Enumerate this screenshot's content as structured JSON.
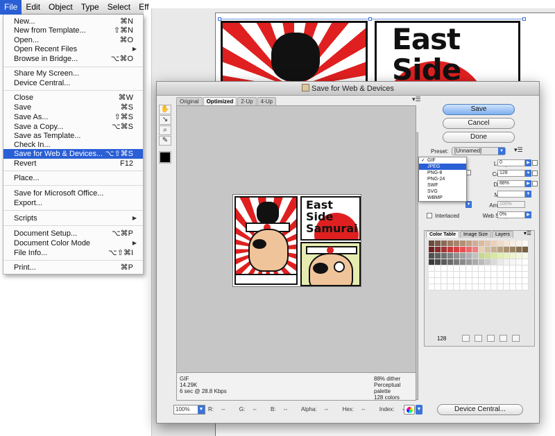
{
  "menubar": {
    "items": [
      "File",
      "Edit",
      "Object",
      "Type",
      "Select",
      "Eff"
    ]
  },
  "file_menu": {
    "items": [
      {
        "label": "New...",
        "key": "⌘N"
      },
      {
        "label": "New from Template...",
        "key": "⇧⌘N"
      },
      {
        "label": "Open...",
        "key": "⌘O"
      },
      {
        "label": "Open Recent Files",
        "key": ""
      },
      {
        "label": "Browse in Bridge...",
        "key": "⌥⌘O"
      },
      {
        "label": "Share My Screen...",
        "key": ""
      },
      {
        "label": "Device Central...",
        "key": ""
      },
      {
        "label": "Close",
        "key": "⌘W"
      },
      {
        "label": "Save",
        "key": "⌘S"
      },
      {
        "label": "Save As...",
        "key": "⇧⌘S"
      },
      {
        "label": "Save a Copy...",
        "key": "⌥⌘S"
      },
      {
        "label": "Save as Template...",
        "key": ""
      },
      {
        "label": "Check In...",
        "key": ""
      },
      {
        "label": "Save for Web & Devices...",
        "key": "⌥⇧⌘S"
      },
      {
        "label": "Revert",
        "key": "F12"
      },
      {
        "label": "Place...",
        "key": ""
      },
      {
        "label": "Save for Microsoft Office...",
        "key": ""
      },
      {
        "label": "Export...",
        "key": ""
      },
      {
        "label": "Scripts",
        "key": ""
      },
      {
        "label": "Document Setup...",
        "key": "⌥⌘P"
      },
      {
        "label": "Document Color Mode",
        "key": ""
      },
      {
        "label": "File Info...",
        "key": "⌥⇧⌘I"
      },
      {
        "label": "Print...",
        "key": "⌘P"
      }
    ],
    "highlighted": "Save for Web & Devices..."
  },
  "artwork": {
    "text_large": "East\nSide",
    "text_small": "East\nSide\nSamurai"
  },
  "dialog": {
    "title": "Save for Web & Devices",
    "tabs": [
      "Original",
      "Optimized",
      "2-Up",
      "4-Up"
    ],
    "active_tab": "Optimized",
    "buttons": {
      "save": "Save",
      "cancel": "Cancel",
      "done": "Done",
      "device_central": "Device Central..."
    },
    "preview_info": {
      "format": "GIF",
      "size": "14.29K",
      "time": "6 sec @ 28.8 Kbps",
      "dither": "88% dither",
      "palette": "Perceptual palette",
      "colors": "128 colors"
    },
    "status": {
      "zoom": "100%",
      "r": "R:",
      "r_val": "--",
      "g": "G:",
      "g_val": "--",
      "b": "B:",
      "b_val": "--",
      "alpha": "Alpha:",
      "alpha_val": "--",
      "hex": "Hex:",
      "hex_val": "--",
      "index": "Index:",
      "index_val": "--"
    },
    "settings": {
      "preset_label": "Preset:",
      "preset_value": "[Unnamed]",
      "format_options": [
        "GIF",
        "JPEG",
        "PNG-8",
        "PNG-24",
        "SWF",
        "SVG",
        "WBMP"
      ],
      "format_checked": "GIF",
      "format_highlighted": "JPEG",
      "lossy_label": "Lossy:",
      "lossy_value": "0",
      "colors_label": "Colors:",
      "colors_value": "128",
      "dither_label": "Dither:",
      "dither_value": "88%",
      "matte_label": "Matte:",
      "amount_label": "Amount:",
      "amount_value": "100%",
      "web_snap_label": "Web Snap:",
      "web_snap_value": "0%",
      "interlaced_label": "Interlaced"
    },
    "color_table": {
      "tabs": [
        "Color Table",
        "Image Size",
        "Layers"
      ],
      "active_tab": "Color Table",
      "count": "128",
      "swatches": [
        "#6b4a3a",
        "#7a5a48",
        "#8c6a55",
        "#9d7a62",
        "#a6856d",
        "#b08f77",
        "#c39e86",
        "#d1ad94",
        "#dcb9a0",
        "#e3c4ad",
        "#ebd0bb",
        "#f0dccb",
        "#f5e6d8",
        "#f8eee4",
        "#faf3ec",
        "#fcf8f3",
        "#6e2222",
        "#8a2a2a",
        "#a83232",
        "#c23a3a",
        "#d84040",
        "#e85050",
        "#e86a6a",
        "#f08080",
        "#e8d0b0",
        "#d8c0a0",
        "#c8b090",
        "#b8a080",
        "#a89070",
        "#988060",
        "#887050",
        "#786040",
        "#505050",
        "#606060",
        "#707070",
        "#808080",
        "#909090",
        "#a0a0a0",
        "#b0b0b0",
        "#c0c0c0",
        "#c8d890",
        "#d0e090",
        "#d8e8a0",
        "#e0f0b0",
        "#e8f0c0",
        "#eef4d0",
        "#f2f6dc",
        "#f6f8e8",
        "#3a3a3a",
        "#4a4a4a",
        "#5a5a5a",
        "#6a6a6a",
        "#7a7a7a",
        "#8a8a8a",
        "#9a9a9a",
        "#aaaaaa",
        "#bababa",
        "#cacaca",
        "#dadada",
        "#eaeaea",
        "#f2f2f2",
        "#f6f6f6",
        "#fafafa",
        "#ffffff",
        "#ffffff",
        "#ffffff",
        "#ffffff",
        "#ffffff",
        "#ffffff",
        "#ffffff",
        "#ffffff",
        "#ffffff",
        "#ffffff",
        "#ffffff",
        "#ffffff",
        "#ffffff",
        "#ffffff",
        "#ffffff",
        "#ffffff",
        "#ffffff",
        "#ffffff",
        "#ffffff",
        "#ffffff",
        "#ffffff",
        "#ffffff",
        "#ffffff",
        "#ffffff",
        "#ffffff",
        "#ffffff",
        "#ffffff",
        "#ffffff",
        "#ffffff",
        "#ffffff",
        "#ffffff",
        "#ffffff",
        "#ffffff",
        "#ffffff",
        "#ffffff",
        "#ffffff",
        "#ffffff",
        "#ffffff",
        "#ffffff",
        "#ffffff",
        "#ffffff",
        "#ffffff",
        "#ffffff",
        "#ffffff",
        "#ffffff",
        "#ffffff",
        "#ffffff",
        "#ffffff",
        "#ffffff",
        "#ffffff",
        "#ffffff",
        "#ffffff",
        "#ffffff",
        "#ffffff",
        "#ffffff",
        "#ffffff",
        "#ffffff",
        "#ffffff",
        "#ffffff",
        "#ffffff",
        "#ffffff",
        "#ffffff",
        "#ffffff",
        "#ffffff",
        "#ffffff"
      ]
    }
  },
  "colors": {
    "menu_highlight": "#2a5fd5",
    "primary_button": "#7fb0ee",
    "art_red": "#e02020"
  }
}
